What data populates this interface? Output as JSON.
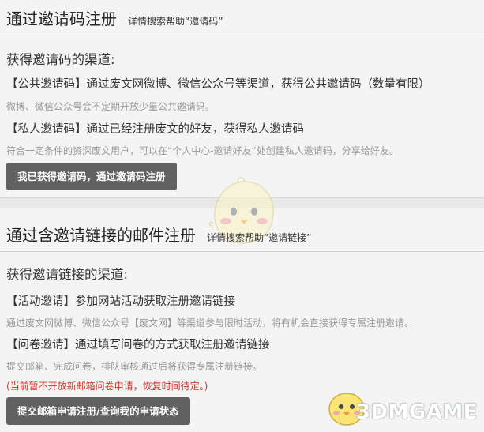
{
  "invite_code_section": {
    "title": "通过邀请码注册",
    "hint": "详情搜索帮助“邀请码”",
    "channels_title": "获得邀请码的渠道:",
    "public_item": "【公共邀请码】通过废文网微博、微信公众号等渠道，获得公共邀请码（数量有限）",
    "public_note": "微博、微信公众号会不定期开放少量公共邀请码。",
    "private_item": "【私人邀请码】通过已经注册废文的好友，获得私人邀请码",
    "private_note": "符合一定条件的资深废文用户，可以在“个人中心-邀请好友”处创建私人邀请码，分享给好友。",
    "button_label": "我已获得邀请码，通过邀请码注册"
  },
  "invite_link_section": {
    "title": "通过含邀请链接的邮件注册",
    "hint": "详情搜索帮助“邀请链接”",
    "channels_title": "获得邀请链接的渠道:",
    "activity_item": "【活动邀请】参加网站活动获取注册邀请链接",
    "activity_note": "通过废文网微博、微信公众号【废文网】等渠道参与限时活动，将有机会直接获得专属注册邀请。",
    "survey_item": "【问卷邀请】通过填写问卷的方式获取注册邀请链接",
    "survey_note": "提交邮箱、完成问卷，排队审核通过后将获得专属注册链接。",
    "warning": "(当前暂不开放新邮箱问卷申请，恢复时间待定。)",
    "button_label": "提交邮箱申请注册/查询我的申请状态"
  },
  "watermark": {
    "text": "3DMGAME"
  },
  "colors": {
    "background": "#f4f4f4",
    "button": "#616161",
    "warning": "#d0342c",
    "note": "#999999"
  }
}
